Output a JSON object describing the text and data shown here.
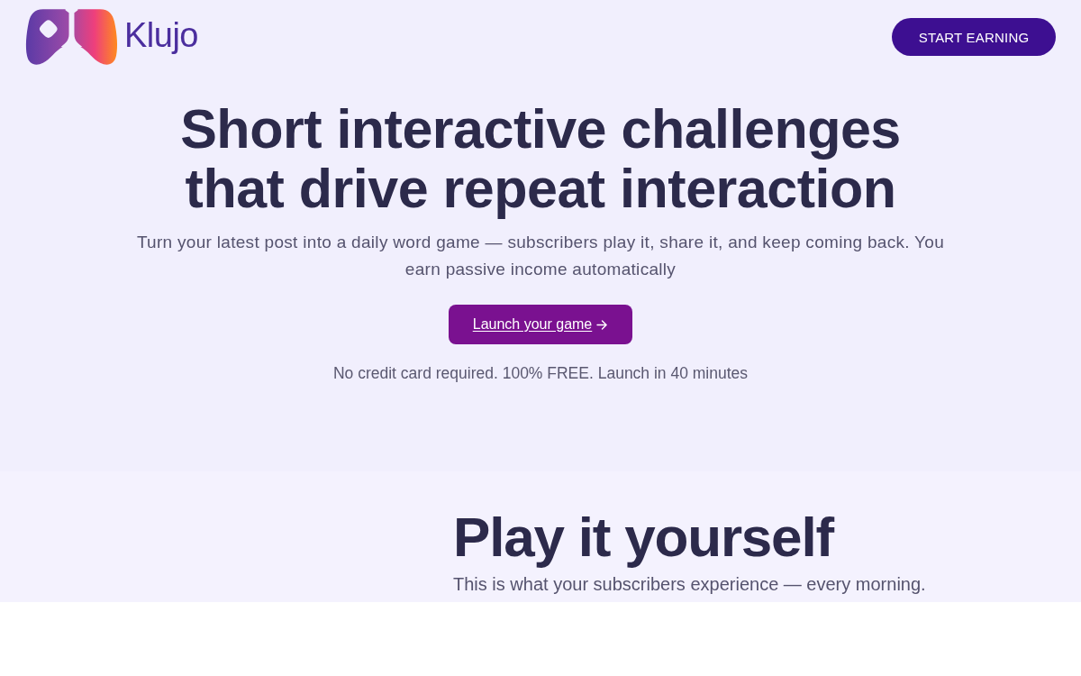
{
  "header": {
    "logo": {
      "wordmark": "Klujo"
    },
    "cta_button": {
      "label": "START EARNING"
    }
  },
  "hero": {
    "title_lines": [
      "Short interactive challenges",
      "that drive repeat interaction"
    ],
    "subtitle": "Turn your latest post into a daily word game — subscribers play it, share it, and keep coming back. You earn passive income automatically",
    "button": {
      "label": "Launch your game"
    },
    "note": "No credit card required. 100% FREE. Launch in 40 minutes"
  },
  "demo_section": {
    "title": "Play it yourself",
    "subtitle": "This is what your subscribers experience — every morning."
  }
}
